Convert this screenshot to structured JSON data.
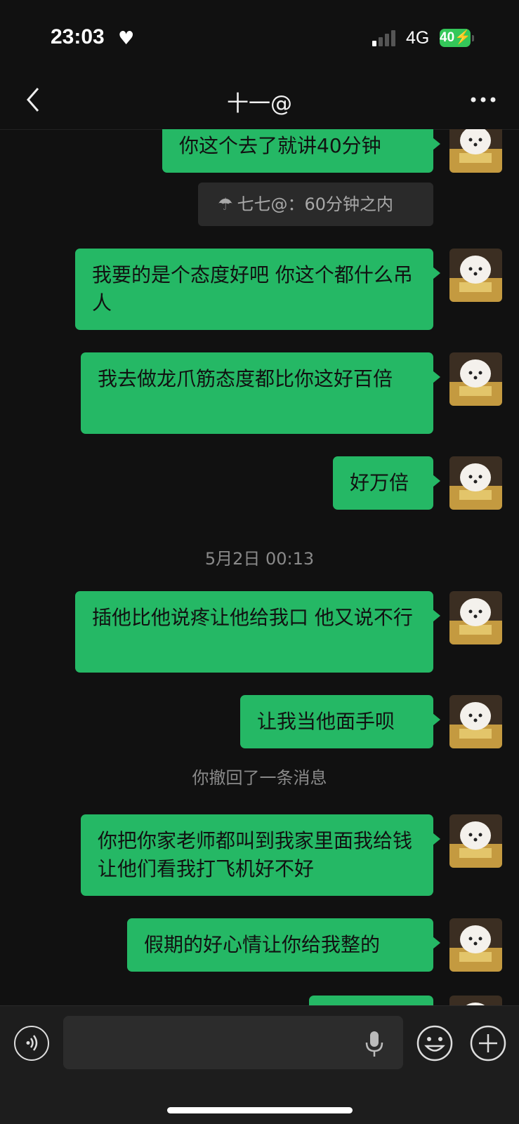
{
  "status": {
    "time": "23:03",
    "network": "4G",
    "battery": "40"
  },
  "nav": {
    "title": "十一@"
  },
  "messages": [
    {
      "text": "你这个去了就讲40分钟"
    },
    {
      "text": "我要的是个态度好吧 你这个都什么吊人"
    },
    {
      "text": "我去做龙爪筋态度都比你这好百倍"
    },
    {
      "text": "好万倍"
    },
    {
      "text": "插他比他说疼让他给我口 他又说不行"
    },
    {
      "text": "让我当他面手呗"
    },
    {
      "text": "你把你家老师都叫到我家里面我给钱让他们看我打飞机好不好"
    },
    {
      "text": "假期的好心情让你给我整的"
    }
  ],
  "quote": {
    "icon": "umbrella-icon",
    "text": "七七@：60分钟之内"
  },
  "timestamp": "5月2日 00:13",
  "recall_notice": "你撤回了一条消息",
  "colors": {
    "bubble": "#25b865",
    "background": "#111111"
  }
}
